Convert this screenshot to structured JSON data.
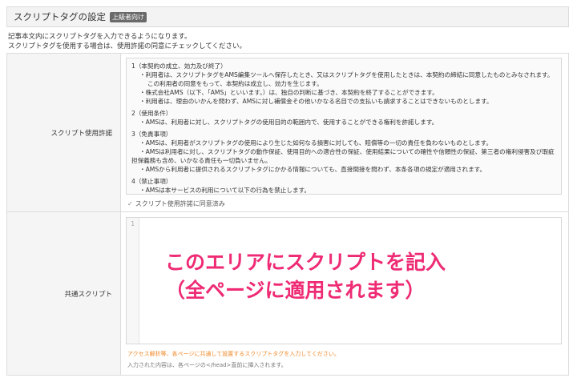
{
  "header": {
    "title": "スクリプトタグの設定",
    "badge": "上級者向け"
  },
  "description": {
    "line1": "記事本文内にスクリプトタグを入力できるようになります。",
    "line2": "スクリプトタグを使用する場合は、使用許諾の同意にチェックしてください。"
  },
  "license_row": {
    "label": "スクリプト使用許諾",
    "terms": {
      "s1_title": "1（本契約の成立、効力及び終了）",
      "s1_l1": "・利用者は、スクリプトタグをAMS編集ツールへ保存したとき、又はスクリプトタグを使用したときは、本契約の締結に同意したものとみなされます。",
      "s1_l1b": "この利用者の同意をもって、本契約は成立し、効力を生じます。",
      "s1_l2": "・株式会社AMS（以下、「AMS」といいます。）は、独自の判断に基づき、本契約を終了することができます。",
      "s1_l3": "・利用者は、理由のいかんを問わず、AMSに対し補償金その他いかなる名目での支払いも請求することはできないものとします。",
      "s2_title": "2（使用条件）",
      "s2_l1": "・AMSは、利用者に対し、スクリプトタグの使用目的の範囲内で、使用することができる権利を許諾します。",
      "s3_title": "3（免責事項）",
      "s3_l1": "・AMSは、利用者がスクリプトタグの使用により生じた如何なる損害に対しても、賠償等の一切の責任を負わないものとします。",
      "s3_l2": "・AMSは利用者に対し、スクリプトタグの動作保証、使用目的への適合性の保証、使用結果についての確性や信頼性の保証、第三者の権利侵害及び瑕疵",
      "s3_l2b": "担保義務も含め、いかなる責任も一切負いません。",
      "s3_l3": "・AMSから利用者に提供されるスクリプトタグにかかる情報についても、直接間接を問わず、本条各項の規定が適用されます。",
      "s4_title": "4（禁止事項）",
      "s4_l1": "・AMSは本サービスの利用について以下の行為を禁止します。"
    },
    "agree_label": "スクリプト使用許諾に同意済み"
  },
  "script_row": {
    "label": "共通スクリプト",
    "line_number": "1",
    "overlay_line1": "このエリアにスクリプトを記入",
    "overlay_line2": "（全ページに適用されます）",
    "hint": "アクセス解析等、各ページに共通して設置するスクリプトタグを入力してください。",
    "note": "入力された内容は、各ページの</head>直前に挿入されます。"
  },
  "colors": {
    "overlay": "#ee2b74",
    "hint": "#f08a2b"
  }
}
